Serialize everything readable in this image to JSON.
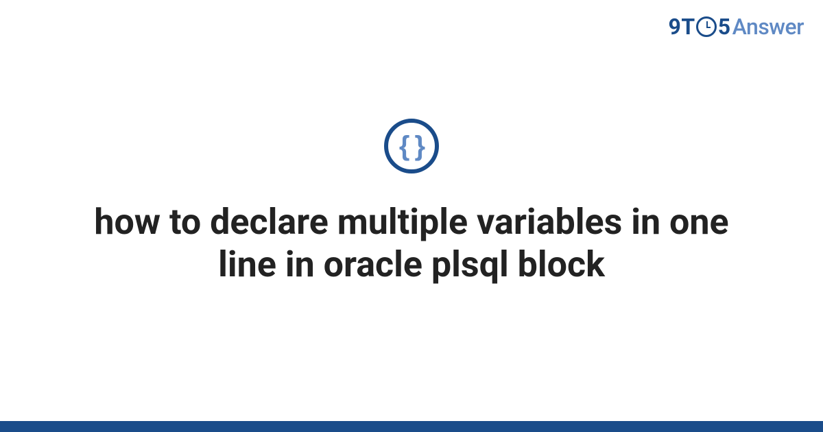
{
  "logo": {
    "nine": "9",
    "t": "T",
    "five": "5",
    "answer": "Answer"
  },
  "icon": {
    "braces": "{ }"
  },
  "title": "how to declare multiple variables in one line in oracle plsql block",
  "colors": {
    "primary": "#1a4c8a",
    "secondary": "#5f89c4",
    "text": "#222222",
    "background": "#ffffff"
  }
}
